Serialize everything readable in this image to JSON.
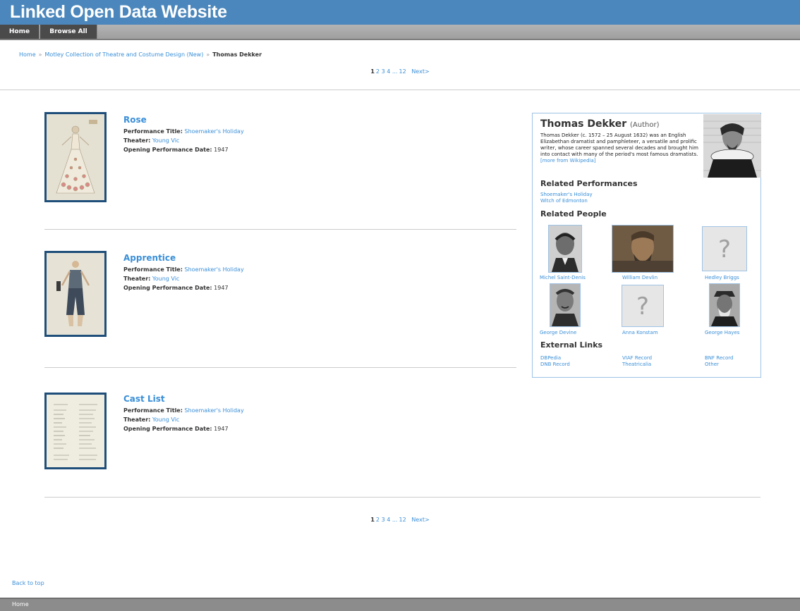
{
  "header": {
    "title": "Linked Open Data Website"
  },
  "nav": {
    "home": "Home",
    "browse_all": "Browse All"
  },
  "breadcrumb": {
    "home": "Home",
    "collection": "Motley Collection of Theatre and Costume Design (New)",
    "current": "Thomas Dekker",
    "separator": "»"
  },
  "pagination": {
    "current": "1",
    "pages": [
      "2",
      "3",
      "4"
    ],
    "ellipsis": "...",
    "last": "12",
    "next": "Next>"
  },
  "labels": {
    "performance_title": "Performance Title:",
    "theater": "Theater:",
    "opening_date": "Opening Performance Date:"
  },
  "items": [
    {
      "title": "Rose",
      "performance_title": "Shoemaker's Holiday",
      "theater": "Young Vic",
      "opening_date": "1947"
    },
    {
      "title": "Apprentice",
      "performance_title": "Shoemaker's Holiday",
      "theater": "Young Vic",
      "opening_date": "1947"
    },
    {
      "title": "Cast List",
      "performance_title": "Shoemaker's Holiday",
      "theater": "Young Vic",
      "opening_date": "1947"
    }
  ],
  "sidebar": {
    "name": "Thomas Dekker",
    "role": "(Author)",
    "bio": "Thomas Dekker (c. 1572 – 25 August 1632) was an English Elizabethan dramatist and pamphleteer, a versatile and prolific writer, whose career spanned several decades and brought him into contact with many of the period's most famous dramatists.",
    "more_link": "[more from Wikipedia]",
    "related_performances_heading": "Related Performances",
    "related_performances": [
      "Shoemaker's Holiday",
      "Witch of Edmonton"
    ],
    "related_people_heading": "Related People",
    "related_people": [
      {
        "name": "Michel Saint-Denis"
      },
      {
        "name": "William Devlin"
      },
      {
        "name": "Hedley Briggs",
        "placeholder": "?"
      },
      {
        "name": "George Devine"
      },
      {
        "name": "Anna Konstam",
        "placeholder": "?"
      },
      {
        "name": "George Hayes"
      }
    ],
    "external_links_heading": "External Links",
    "external_links": [
      "DBPedia",
      "VIAF Record",
      "BNF Record",
      "DNB Record",
      "Theatricalia",
      "Other"
    ]
  },
  "back_to_top": "Back to top",
  "footer": {
    "home": "Home"
  },
  "colors": {
    "header_blue": "#4b87bc",
    "link_blue": "#3a8fd8",
    "thumb_border": "#1e4e79"
  }
}
